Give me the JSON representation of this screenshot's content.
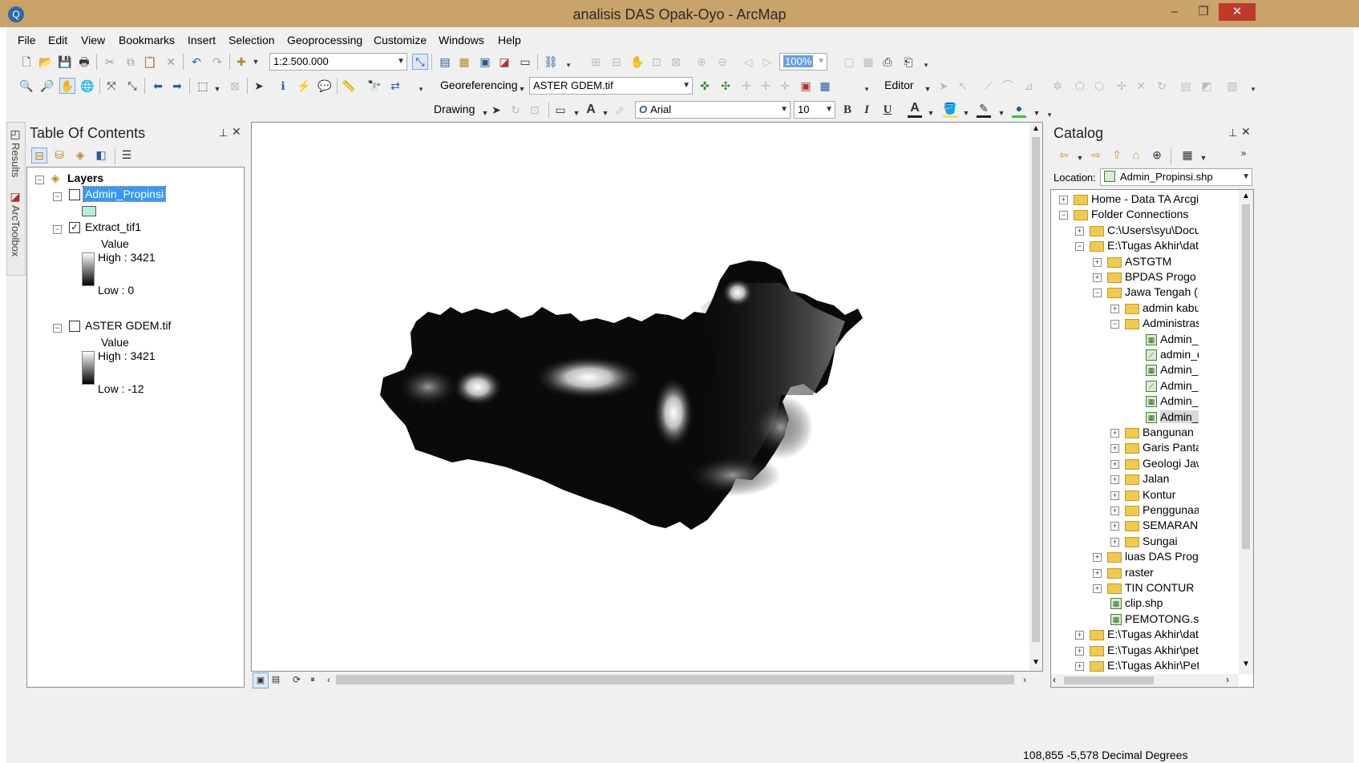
{
  "window": {
    "title": "analisis DAS Opak-Oyo - ArcMap",
    "minimize": "–",
    "restore": "❐",
    "close": "✕"
  },
  "menu": [
    "File",
    "Edit",
    "View",
    "Bookmarks",
    "Insert",
    "Selection",
    "Geoprocessing",
    "Customize",
    "Windows",
    "Help"
  ],
  "toolbar": {
    "scale_value": "1:2.500.000",
    "zoom_value": "100%",
    "georef_label": "Georeferencing",
    "georef_layer": "ASTER GDEM.tif",
    "editor_label": "Editor",
    "drawing_label": "Drawing",
    "font_name": "Arial",
    "font_size": "10",
    "bold": "B",
    "italic": "I",
    "underline": "U",
    "font_color_glyph": "A"
  },
  "side_tabs": [
    "Results",
    "ArcToolbox"
  ],
  "toc": {
    "title": "Table Of Contents",
    "pin": "📌",
    "close": "✕",
    "root": "Layers",
    "layers": [
      {
        "name": "Admin_Propinsi",
        "checked": false,
        "selected": true
      },
      {
        "name": "Extract_tif1",
        "checked": true,
        "value_label": "Value",
        "high": "High : 3421",
        "low": "Low : 0"
      },
      {
        "name": "ASTER GDEM.tif",
        "checked": false,
        "value_label": "Value",
        "high": "High : 3421",
        "low": "Low : -12"
      }
    ]
  },
  "catalog": {
    "title": "Catalog",
    "pin": "📌",
    "close": "✕",
    "location_label": "Location:",
    "location_value": "Admin_Propinsi.shp",
    "items": [
      {
        "label": "Home - Data TA Arcgis\\Projec",
        "level": 0,
        "exp": "+",
        "icon": "home"
      },
      {
        "label": "Folder Connections",
        "level": 0,
        "exp": "−",
        "icon": "folderconn"
      },
      {
        "label": "C:\\Users\\syu\\Documents\\",
        "level": 1,
        "exp": "+",
        "icon": "folderconn"
      },
      {
        "label": "E:\\Tugas Akhir\\data arcgis",
        "level": 1,
        "exp": "−",
        "icon": "folderconn"
      },
      {
        "label": "ASTGTM",
        "level": 2,
        "exp": "+",
        "icon": "folder"
      },
      {
        "label": "BPDAS Progo Opak Se",
        "level": 2,
        "exp": "+",
        "icon": "folder"
      },
      {
        "label": "Jawa Tengah (Pak Sury",
        "level": 2,
        "exp": "−",
        "icon": "folder"
      },
      {
        "label": "admin kabupaten r",
        "level": 3,
        "exp": "+",
        "icon": "folder"
      },
      {
        "label": "Administrasi",
        "level": 3,
        "exp": "−",
        "icon": "folder"
      },
      {
        "label": "Admin_Desa.sh",
        "level": 4,
        "exp": "",
        "icon": "shp"
      },
      {
        "label": "admin_desa_lin",
        "level": 4,
        "exp": "",
        "icon": "line"
      },
      {
        "label": "Admin_Kabupa",
        "level": 4,
        "exp": "",
        "icon": "shp"
      },
      {
        "label": "Admin_Kec_line",
        "level": 4,
        "exp": "",
        "icon": "line"
      },
      {
        "label": "Admin_Kecama",
        "level": 4,
        "exp": "",
        "icon": "shp"
      },
      {
        "label": "Admin_Propins",
        "level": 4,
        "exp": "",
        "icon": "shp",
        "selected": true
      },
      {
        "label": "Bangunan",
        "level": 3,
        "exp": "+",
        "icon": "folder"
      },
      {
        "label": "Garis Pantai",
        "level": 3,
        "exp": "+",
        "icon": "folder"
      },
      {
        "label": "Geologi Jawa shp",
        "level": 3,
        "exp": "+",
        "icon": "folder"
      },
      {
        "label": "Jalan",
        "level": 3,
        "exp": "+",
        "icon": "folder"
      },
      {
        "label": "Kontur",
        "level": 3,
        "exp": "+",
        "icon": "folder"
      },
      {
        "label": "PenggunaanLahan",
        "level": 3,
        "exp": "+",
        "icon": "folder"
      },
      {
        "label": "SEMARANG",
        "level": 3,
        "exp": "+",
        "icon": "folder"
      },
      {
        "label": "Sungai",
        "level": 3,
        "exp": "+",
        "icon": "folder"
      },
      {
        "label": "luas DAS Progo)",
        "level": 2,
        "exp": "+",
        "icon": "folder"
      },
      {
        "label": "raster",
        "level": 2,
        "exp": "+",
        "icon": "folder"
      },
      {
        "label": "TIN CONTUR",
        "level": 2,
        "exp": "+",
        "icon": "folder"
      },
      {
        "label": "clip.shp",
        "level": 2,
        "exp": "",
        "icon": "shp"
      },
      {
        "label": "PEMOTONG.shp",
        "level": 2,
        "exp": "",
        "icon": "shp"
      },
      {
        "label": "E:\\Tugas Akhir\\data TA Ar",
        "level": 1,
        "exp": "+",
        "icon": "folderconn"
      },
      {
        "label": "E:\\Tugas Akhir\\peta baru",
        "level": 1,
        "exp": "+",
        "icon": "folderconn"
      },
      {
        "label": "E:\\Tugas Akhir\\Peta\\admi",
        "level": 1,
        "exp": "+",
        "icon": "folderconn"
      }
    ]
  },
  "status": {
    "coords": "108,855  -5,578 Decimal Degrees"
  },
  "colors": {
    "titlebar": "#c9a36a",
    "close_button": "#c0392b",
    "selection": "#3399ff",
    "legend_fill": "#b7ecdf"
  }
}
